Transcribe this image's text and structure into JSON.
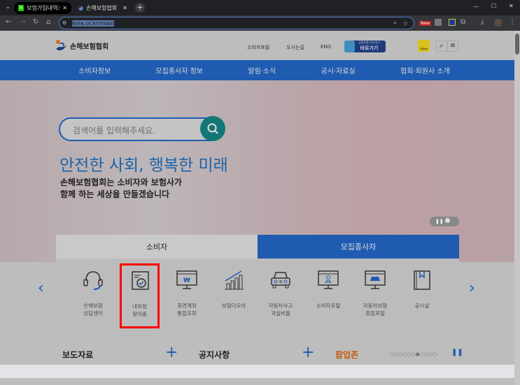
{
  "browser": {
    "tabs": [
      {
        "title": "보험가입내역조회"
      },
      {
        "title": "손해보험협회"
      }
    ],
    "url": "knia.or.kr/main",
    "ext_badge": "New"
  },
  "header": {
    "logo": "손해보험협회",
    "links": [
      "소비자포털",
      "오시는길",
      "ENG"
    ],
    "banner_small": "금융상품 비교공시",
    "banner_big": "바로가기",
    "kakao": "카톡상담"
  },
  "nav": [
    "소비자정보",
    "모집종사자 정보",
    "알림·소식",
    "공시·자료실",
    "협회·회원사 소개"
  ],
  "hero": {
    "search_placeholder": "검색어를 입력해주세요.",
    "headline": "안전한 사회, 행복한 미래",
    "sub1": "손해보험협회는 소비자와 보험사가",
    "sub2": "함께 하는 세상을 만들겠습니다"
  },
  "panel": {
    "tabs": [
      "소비자",
      "모집종사자"
    ],
    "items": [
      {
        "l1": "손해보험",
        "l2": "상담센터"
      },
      {
        "l1": "내보험",
        "l2": "찾아줌"
      },
      {
        "l1": "휴면계좌",
        "l2": "통합조회"
      },
      {
        "l1": "보험다모아",
        "l2": ""
      },
      {
        "l1": "자동차사고",
        "l2": "과실비율"
      },
      {
        "l1": "소비자포털",
        "l2": ""
      },
      {
        "l1": "자동차보험",
        "l2": "종합포털"
      },
      {
        "l1": "공시실",
        "l2": ""
      }
    ]
  },
  "bottom": {
    "press": "보도자료",
    "notice": "공지사항",
    "popup": "팝업존",
    "dots": "○○○○○○●○○○○"
  },
  "colors": {
    "nav": "#1f5bb0",
    "highlight": "#ff0000",
    "popup": "#c65a0e"
  }
}
